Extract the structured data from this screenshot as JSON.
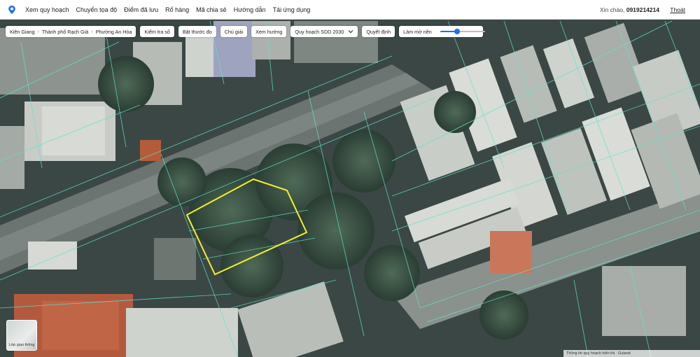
{
  "nav": {
    "logo_icon": "map-pin-logo",
    "items": [
      {
        "label": "Xem quy hoạch"
      },
      {
        "label": "Chuyển tọa độ"
      },
      {
        "label": "Điểm đã lưu"
      },
      {
        "label": "Rổ hàng"
      },
      {
        "label": "Mã chia sẻ"
      },
      {
        "label": "Hướng dẫn"
      },
      {
        "label": "Tải ứng dụng"
      }
    ],
    "greeting": "Xin chào,",
    "phone": "0919214214",
    "logout": "Thoát"
  },
  "toolbar": {
    "breadcrumb": [
      "Kiên Giang",
      "Thành phố Rạch Giá",
      "Phường An Hòa"
    ],
    "check_land": "Kiểm tra số",
    "measure": "Bật thước đo",
    "legend": "Chú giải",
    "view_direction": "Xem hướng",
    "plan_select": "Quy hoạch SDD 2030",
    "decision": "Quyết định",
    "blur_label": "Làm mờ nền",
    "blur_level": 0.45
  },
  "layer_button": "Lớp giao thông",
  "footer_note": "Thông tin quy hoạch hiển thị · Guland",
  "colors": {
    "accent": "#1a73e8",
    "parcel_outline": "#f2ef2a",
    "cadastral_lines": "#5fe3cf"
  }
}
